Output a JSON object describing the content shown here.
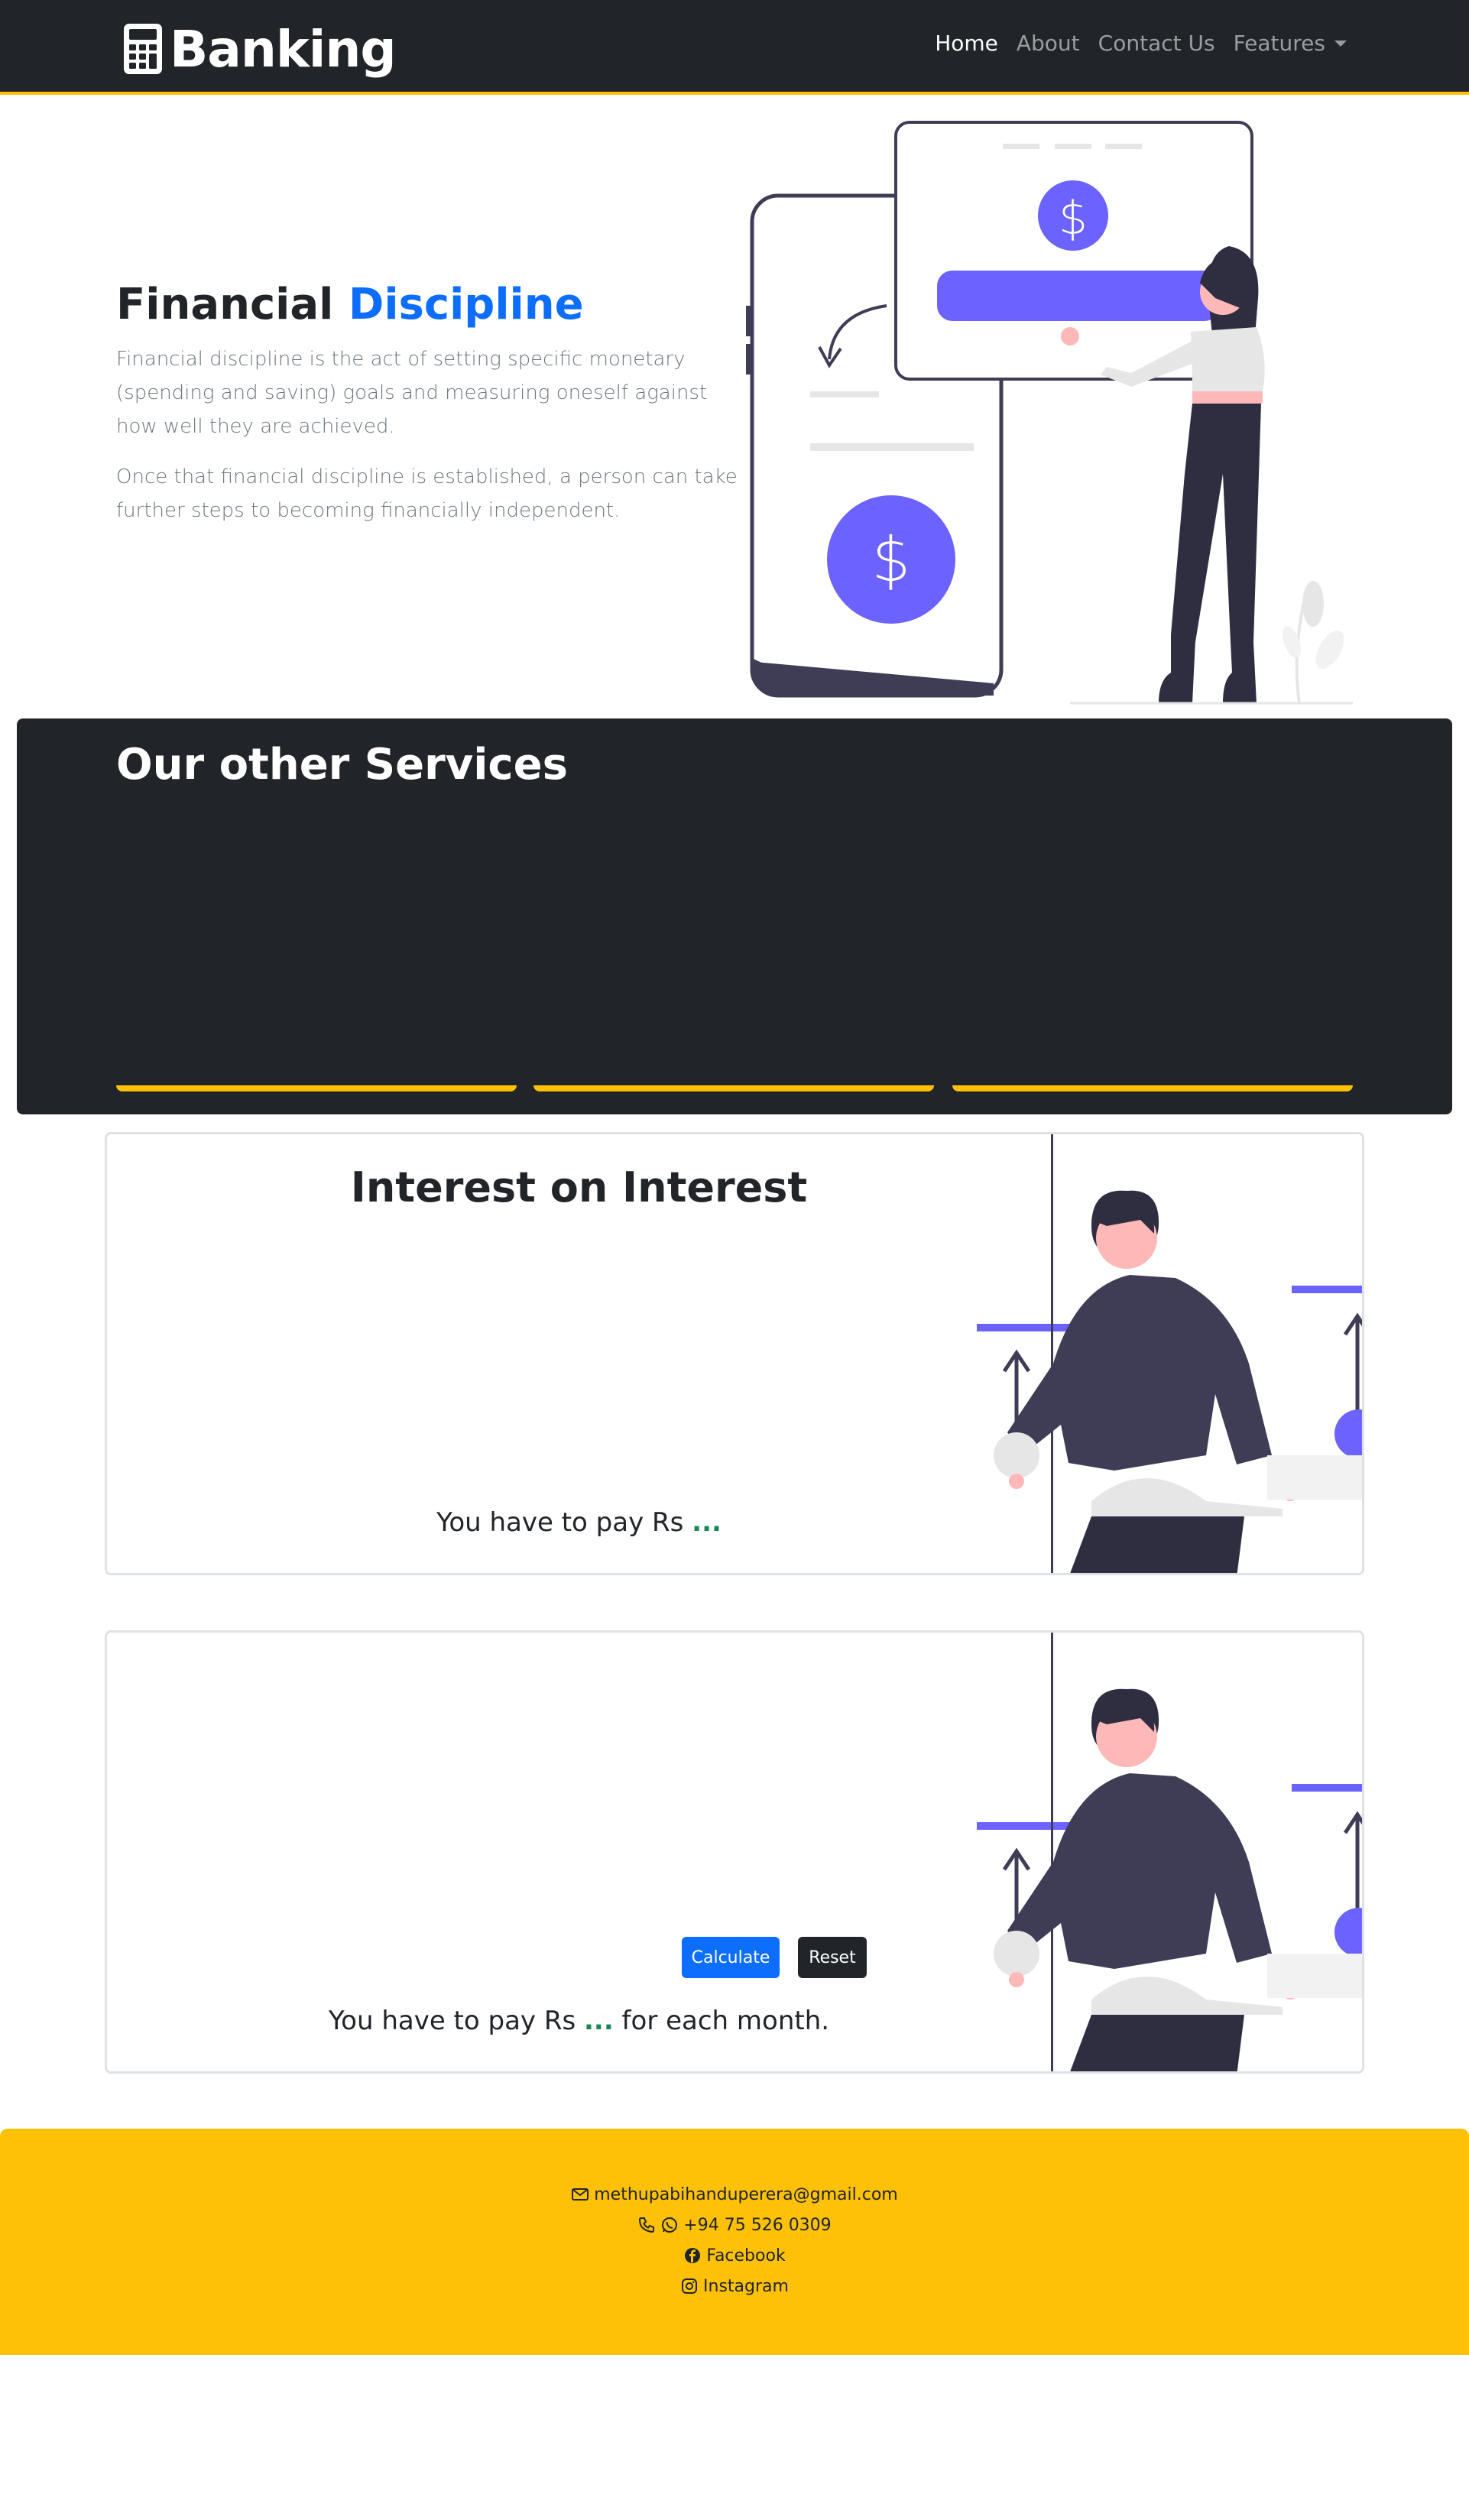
{
  "navbar": {
    "brand": "Banking",
    "brand_icon": "calculator-icon",
    "links": [
      {
        "label": "Home",
        "active": true
      },
      {
        "label": "About",
        "active": false
      },
      {
        "label": "Contact Us",
        "active": false
      },
      {
        "label": "Features",
        "active": false,
        "dropdown": true
      }
    ]
  },
  "hero": {
    "title_part1": "Financial",
    "title_part2": "Discipline",
    "paragraph1": "Financial discipline is the act of setting specific monetary (spending and saving) goals and measuring oneself against how well they are achieved.",
    "paragraph2": "Once that financial discipline is established, a person can take further steps to becoming financially independent."
  },
  "services": {
    "title": "Our other Services",
    "card_count": 3
  },
  "interest_card": {
    "title": "Interest on Interest",
    "result_prefix": "You have to pay Rs",
    "result_value": "..."
  },
  "installment_card": {
    "calculate_label": "Calculate",
    "reset_label": "Reset",
    "result_prefix": "You have to pay Rs",
    "result_value": "...",
    "result_suffix": "for each month."
  },
  "footer": {
    "email": "methupabihanduperera@gmail.com",
    "phone": "+94 75 526 0309",
    "facebook": "Facebook",
    "instagram": "Instagram"
  },
  "colors": {
    "dark": "#212529",
    "accent_yellow": "#ffc107",
    "primary_blue": "#0d6efd",
    "illustration_purple": "#6c63ff",
    "success_green": "#198754"
  }
}
